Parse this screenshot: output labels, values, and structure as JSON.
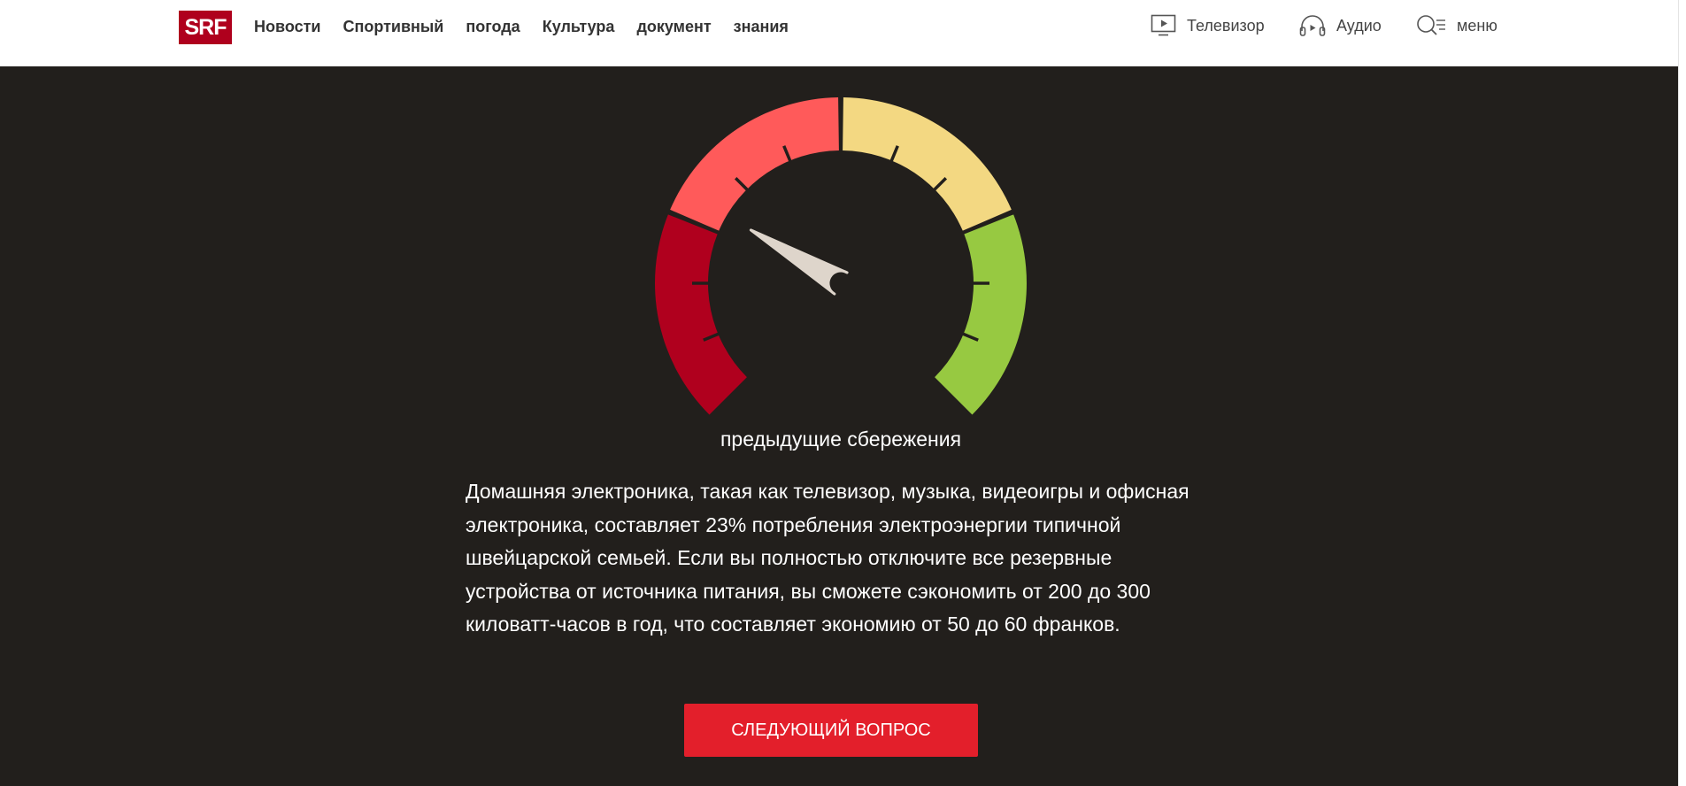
{
  "header": {
    "logo_text": "SRF",
    "nav_items": [
      "Новости",
      "Спортивный",
      "погода",
      "Культура",
      "документ",
      "знания"
    ],
    "tv_label": "Телевизор",
    "audio_label": "Аудио",
    "menu_label": "меню"
  },
  "gauge": {
    "zones": [
      {
        "name": "dark-red",
        "color": "#b0001e"
      },
      {
        "name": "light-red",
        "color": "#ff5a5a"
      },
      {
        "name": "yellow",
        "color": "#f3d882"
      },
      {
        "name": "green",
        "color": "#97c941"
      }
    ],
    "needle_color": "#ded5cb",
    "needle_level": 0.28,
    "caption": "предыдущие сбережения"
  },
  "answer_text": "Домашняя электроника, такая как телевизор, музыка, видеоигры и офисная электроника, составляет 23% потребления электроэнергии типичной швейцарской семьей. Если вы полностью отключите все резервные устройства от источника питания, вы сможете сэкономить от 200 до 300 киловатт-часов в год, что составляет экономию от 50 до 60 франков.",
  "next_button_label": "Следующий вопрос"
}
